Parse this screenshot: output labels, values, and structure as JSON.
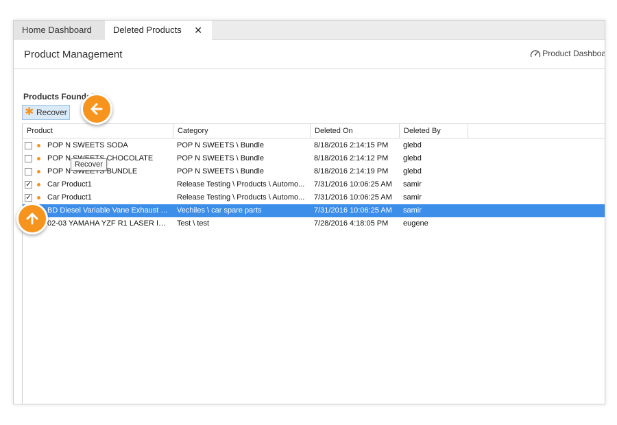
{
  "tabs": [
    {
      "label": "Home Dashboard"
    },
    {
      "label": "Deleted Products",
      "close": "✕"
    }
  ],
  "header": {
    "title": "Product Management",
    "dashboard_link": "Product Dashboa"
  },
  "products_found": "Products Found: 7",
  "toolbar": {
    "recover_label": "Recover"
  },
  "tooltip": "Recover",
  "grid": {
    "columns": [
      "Product",
      "Category",
      "Deleted On",
      "Deleted By"
    ],
    "rows": [
      {
        "checked": "",
        "product": "POP N SWEETS SODA",
        "category": "POP N SWEETS \\ Bundle",
        "deleted_on": "8/18/2016 2:14:15 PM",
        "deleted_by": "glebd"
      },
      {
        "checked": "",
        "product": "POP N SWEETS CHOCOLATE",
        "category": "POP N SWEETS \\ Bundle",
        "deleted_on": "8/18/2016 2:14:12 PM",
        "deleted_by": "glebd"
      },
      {
        "checked": "",
        "product": "POP N SWEETS BUNDLE",
        "category": "POP N SWEETS \\ Bundle",
        "deleted_on": "8/18/2016 2:14:19 PM",
        "deleted_by": "glebd"
      },
      {
        "checked": "✓",
        "product": "Car Product1",
        "category": "Release Testing \\ Products \\ Automo...",
        "deleted_on": "7/31/2016 10:06:25 AM",
        "deleted_by": "samir"
      },
      {
        "checked": "✓",
        "product": "Car Product1",
        "category": "Release Testing \\ Products \\ Automo...",
        "deleted_on": "7/31/2016 10:06:25 AM",
        "deleted_by": "samir"
      },
      {
        "checked": "",
        "product": "BD Diesel Variable Vane Exhaust Br...",
        "category": "Vechiles \\ car spare parts",
        "deleted_on": "7/31/2016 10:06:25 AM",
        "deleted_by": "samir"
      },
      {
        "checked": "",
        "product": "02-03 YAMAHA YZF R1 LASER IRID...",
        "category": "Test \\ test",
        "deleted_on": "7/28/2016 4:18:05 PM",
        "deleted_by": "eugene"
      }
    ]
  },
  "colors": {
    "accent": "#f7941d",
    "selection": "#3d8ee9",
    "button_bg": "#dbeaf8"
  },
  "icons": {
    "hint_left": "arrow-left-icon",
    "hint_up": "arrow-up-icon",
    "dashboard": "speedometer-icon",
    "recover": "asterisk-icon"
  }
}
